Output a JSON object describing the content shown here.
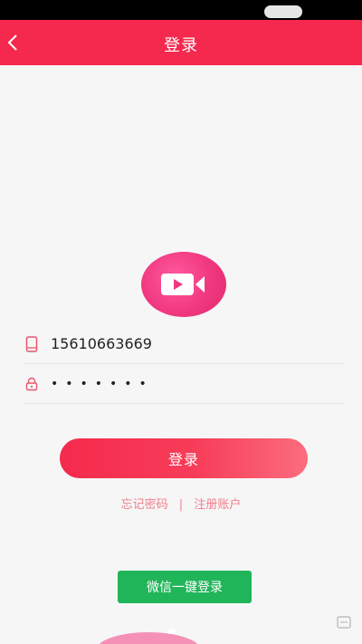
{
  "header": {
    "title": "登录",
    "back_icon": "chevron-left-icon"
  },
  "logo": {
    "icon": "video-camera-icon",
    "color": "#f0387f"
  },
  "phone_field": {
    "icon": "mobile-phone-icon",
    "value": "15610663669"
  },
  "password_field": {
    "icon": "lock-icon",
    "value": "•••••••"
  },
  "login_button": {
    "label": "登录"
  },
  "links": {
    "forgot_password": "忘记密码",
    "separator": "|",
    "register": "注册账户"
  },
  "wechat_button": {
    "label": "微信一键登录"
  },
  "colors": {
    "primary": "#f5284d",
    "link": "#f07f8c",
    "wechat": "#21b55a",
    "background": "#f6f6f6"
  }
}
